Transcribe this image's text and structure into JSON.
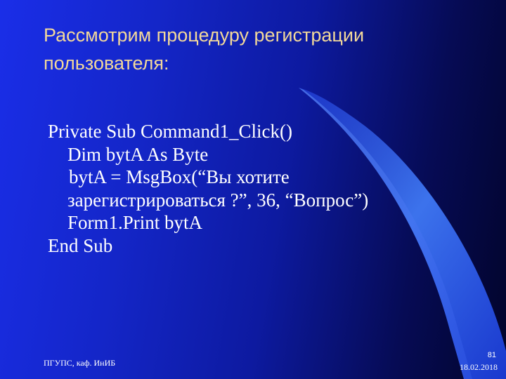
{
  "slide": {
    "title_line1": "Рассмотрим процедуру регистрации",
    "title_line2": "пользователя:",
    "code_lines": [
      "Private Sub Command1_Click()",
      "Dim bytA As Byte",
      "bytA = MsgBox(“Вы хотите",
      "зарегистрироваться ?”, 36, “Вопрос”)",
      "Form1.Print bytA",
      "End Sub"
    ],
    "footer_text": "ПГУПС, каф. ИнИБ",
    "page_number": "81",
    "date": "18.02.2018"
  },
  "colors": {
    "title": "#f2d89a",
    "body_text": "#ffffff",
    "background_light": "#1a2ee8",
    "background_dark": "#02042a",
    "swoosh": "#3a6ef0"
  }
}
